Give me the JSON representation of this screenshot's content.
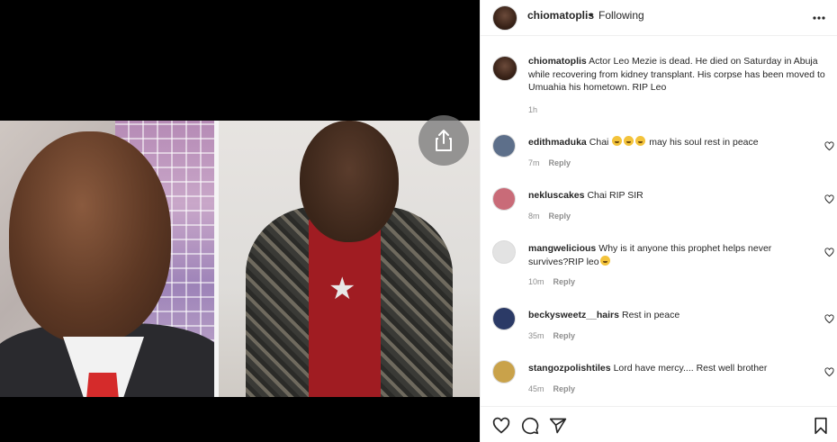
{
  "post": {
    "username": "chiomatoplis",
    "separator": "•",
    "follow_status": "Following",
    "caption_user": "chiomatoplis",
    "caption_text": "Actor Leo Mezie is dead. He died on Saturday in Abuja while recovering from kidney transplant. His corpse has been moved to Umuahia his hometown. RIP Leo",
    "caption_time": "1h"
  },
  "comments": [
    {
      "user": "edithmaduka",
      "text": "Chai",
      "text_after": "may his soul rest in peace",
      "emojis": 3,
      "time": "7m",
      "reply": "Reply",
      "avatar_color": "#5d6f8a"
    },
    {
      "user": "nekluscakes",
      "text": "Chai RIP SIR",
      "time": "8m",
      "reply": "Reply",
      "avatar_color": "#c96b78"
    },
    {
      "user": "mangwelicious",
      "text": "Why is it anyone this prophet helps never survives?RIP leo",
      "emoji_end": true,
      "time": "10m",
      "reply": "Reply",
      "avatar_color": "#e3e3e3"
    },
    {
      "user": "beckysweetz__hairs",
      "text": "Rest in peace",
      "time": "35m",
      "reply": "Reply",
      "avatar_color": "#2b3a66"
    },
    {
      "user": "stangozpolishtiles",
      "text": "Lord have mercy.... Rest well brother",
      "time": "45m",
      "reply": "Reply",
      "avatar_color": "#c9a24a"
    }
  ],
  "icons": {
    "more": "more-options-icon",
    "share": "share-icon",
    "like": "heart-icon",
    "comment": "comment-icon",
    "send": "send-icon",
    "save": "bookmark-icon"
  }
}
